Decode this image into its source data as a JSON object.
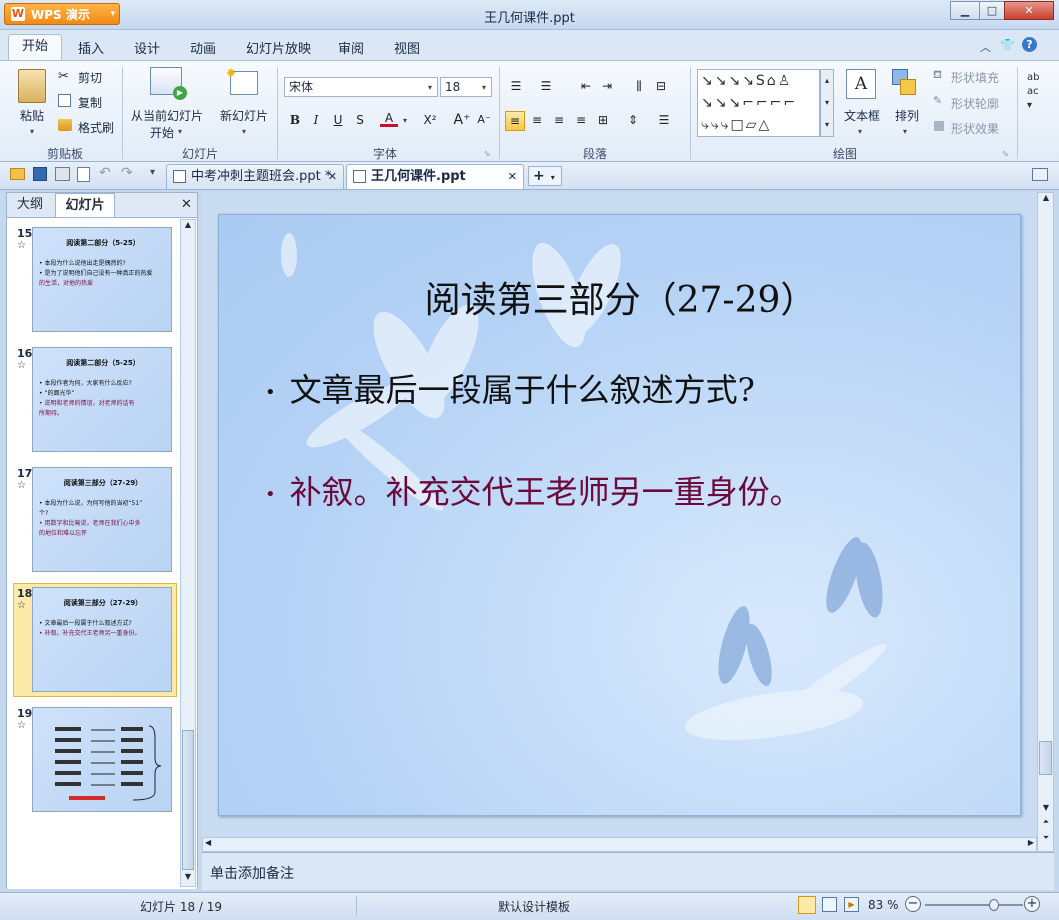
{
  "app": {
    "name": "WPS 演示",
    "window_title": "王几何课件.ppt"
  },
  "ribbon_tabs": [
    "开始",
    "插入",
    "设计",
    "动画",
    "幻灯片放映",
    "审阅",
    "视图"
  ],
  "clipboard": {
    "paste": "粘贴",
    "cut": "剪切",
    "copy": "复制",
    "format_painter": "格式刷",
    "group": "剪贴板"
  },
  "slides_group": {
    "from_current": "从当前幻灯片",
    "start": "开始",
    "new_slide": "新幻灯片",
    "group": "幻灯片"
  },
  "font": {
    "name": "宋体",
    "size": "18",
    "group": "字体"
  },
  "paragraph": {
    "group": "段落"
  },
  "drawing": {
    "textbox": "文本框",
    "arrange": "排列",
    "shape_fill": "形状填充",
    "shape_outline": "形状轮廓",
    "shape_effect": "形状效果",
    "group": "绘图"
  },
  "doc_tabs": [
    "中考冲刺主题班会.ppt *",
    "王几何课件.ppt"
  ],
  "panel_tabs": [
    "大纲",
    "幻灯片"
  ],
  "thumbnails": [
    {
      "num": "15",
      "title": "阅读第二部分（5-25）",
      "lines": [
        "•  本段为什么说他出走是偶然的?",
        "•  是为了说明他们自己没有一种真正的热爱",
        "   的生活，对他的热爱"
      ]
    },
    {
      "num": "16",
      "title": "阅读第二部分（5-25）",
      "lines": [
        "•  本段作者为何，大家有什么反应?",
        "•  “的面光华”",
        "•  说明和老师的情谊，对老师的话有",
        "   所期待。"
      ]
    },
    {
      "num": "17",
      "title": "阅读第三部分（27-29）",
      "lines": [
        "•  本段为什么说，为何写他的当初“51”",
        "   个?",
        "•  用数字和比喻说，老师在我们心中多",
        "   的地位和难以忘怀"
      ]
    },
    {
      "num": "18",
      "title": "阅读第三部分（27-29）",
      "lines": [
        "•  文章最后一段属于什么叙述方式?",
        "•  补叙。补充交代王老师另一重身份。"
      ]
    },
    {
      "num": "19",
      "title": "",
      "lines": []
    }
  ],
  "slide": {
    "title": "阅读第三部分（27-29）",
    "bullet1": "文章最后一段属于什么叙述方式?",
    "bullet2": "补叙。补充交代王老师另一重身份。",
    "bullet2_color": "#6b0a3a"
  },
  "notes_placeholder": "单击添加备注",
  "status": {
    "slide_counter": "幻灯片 18 / 19",
    "template": "默认设计模板",
    "zoom": "83 %",
    "zoom_fraction": 0.83
  },
  "colors": {
    "accent": "#f08a16",
    "ribbon": "#dbe7f5"
  }
}
